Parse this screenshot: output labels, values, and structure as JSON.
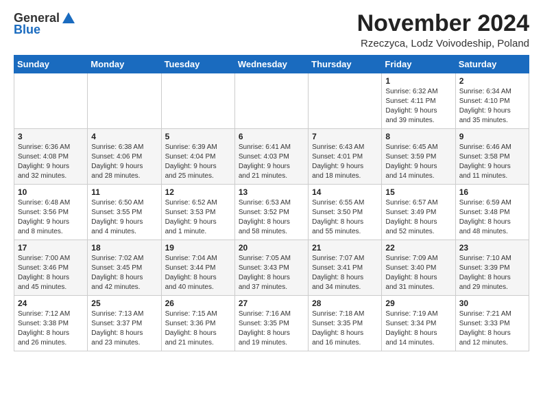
{
  "logo": {
    "general": "General",
    "blue": "Blue"
  },
  "title": "November 2024",
  "subtitle": "Rzeczyca, Lodz Voivodeship, Poland",
  "weekdays": [
    "Sunday",
    "Monday",
    "Tuesday",
    "Wednesday",
    "Thursday",
    "Friday",
    "Saturday"
  ],
  "weeks": [
    [
      {
        "day": "",
        "info": ""
      },
      {
        "day": "",
        "info": ""
      },
      {
        "day": "",
        "info": ""
      },
      {
        "day": "",
        "info": ""
      },
      {
        "day": "",
        "info": ""
      },
      {
        "day": "1",
        "info": "Sunrise: 6:32 AM\nSunset: 4:11 PM\nDaylight: 9 hours\nand 39 minutes."
      },
      {
        "day": "2",
        "info": "Sunrise: 6:34 AM\nSunset: 4:10 PM\nDaylight: 9 hours\nand 35 minutes."
      }
    ],
    [
      {
        "day": "3",
        "info": "Sunrise: 6:36 AM\nSunset: 4:08 PM\nDaylight: 9 hours\nand 32 minutes."
      },
      {
        "day": "4",
        "info": "Sunrise: 6:38 AM\nSunset: 4:06 PM\nDaylight: 9 hours\nand 28 minutes."
      },
      {
        "day": "5",
        "info": "Sunrise: 6:39 AM\nSunset: 4:04 PM\nDaylight: 9 hours\nand 25 minutes."
      },
      {
        "day": "6",
        "info": "Sunrise: 6:41 AM\nSunset: 4:03 PM\nDaylight: 9 hours\nand 21 minutes."
      },
      {
        "day": "7",
        "info": "Sunrise: 6:43 AM\nSunset: 4:01 PM\nDaylight: 9 hours\nand 18 minutes."
      },
      {
        "day": "8",
        "info": "Sunrise: 6:45 AM\nSunset: 3:59 PM\nDaylight: 9 hours\nand 14 minutes."
      },
      {
        "day": "9",
        "info": "Sunrise: 6:46 AM\nSunset: 3:58 PM\nDaylight: 9 hours\nand 11 minutes."
      }
    ],
    [
      {
        "day": "10",
        "info": "Sunrise: 6:48 AM\nSunset: 3:56 PM\nDaylight: 9 hours\nand 8 minutes."
      },
      {
        "day": "11",
        "info": "Sunrise: 6:50 AM\nSunset: 3:55 PM\nDaylight: 9 hours\nand 4 minutes."
      },
      {
        "day": "12",
        "info": "Sunrise: 6:52 AM\nSunset: 3:53 PM\nDaylight: 9 hours\nand 1 minute."
      },
      {
        "day": "13",
        "info": "Sunrise: 6:53 AM\nSunset: 3:52 PM\nDaylight: 8 hours\nand 58 minutes."
      },
      {
        "day": "14",
        "info": "Sunrise: 6:55 AM\nSunset: 3:50 PM\nDaylight: 8 hours\nand 55 minutes."
      },
      {
        "day": "15",
        "info": "Sunrise: 6:57 AM\nSunset: 3:49 PM\nDaylight: 8 hours\nand 52 minutes."
      },
      {
        "day": "16",
        "info": "Sunrise: 6:59 AM\nSunset: 3:48 PM\nDaylight: 8 hours\nand 48 minutes."
      }
    ],
    [
      {
        "day": "17",
        "info": "Sunrise: 7:00 AM\nSunset: 3:46 PM\nDaylight: 8 hours\nand 45 minutes."
      },
      {
        "day": "18",
        "info": "Sunrise: 7:02 AM\nSunset: 3:45 PM\nDaylight: 8 hours\nand 42 minutes."
      },
      {
        "day": "19",
        "info": "Sunrise: 7:04 AM\nSunset: 3:44 PM\nDaylight: 8 hours\nand 40 minutes."
      },
      {
        "day": "20",
        "info": "Sunrise: 7:05 AM\nSunset: 3:43 PM\nDaylight: 8 hours\nand 37 minutes."
      },
      {
        "day": "21",
        "info": "Sunrise: 7:07 AM\nSunset: 3:41 PM\nDaylight: 8 hours\nand 34 minutes."
      },
      {
        "day": "22",
        "info": "Sunrise: 7:09 AM\nSunset: 3:40 PM\nDaylight: 8 hours\nand 31 minutes."
      },
      {
        "day": "23",
        "info": "Sunrise: 7:10 AM\nSunset: 3:39 PM\nDaylight: 8 hours\nand 29 minutes."
      }
    ],
    [
      {
        "day": "24",
        "info": "Sunrise: 7:12 AM\nSunset: 3:38 PM\nDaylight: 8 hours\nand 26 minutes."
      },
      {
        "day": "25",
        "info": "Sunrise: 7:13 AM\nSunset: 3:37 PM\nDaylight: 8 hours\nand 23 minutes."
      },
      {
        "day": "26",
        "info": "Sunrise: 7:15 AM\nSunset: 3:36 PM\nDaylight: 8 hours\nand 21 minutes."
      },
      {
        "day": "27",
        "info": "Sunrise: 7:16 AM\nSunset: 3:35 PM\nDaylight: 8 hours\nand 19 minutes."
      },
      {
        "day": "28",
        "info": "Sunrise: 7:18 AM\nSunset: 3:35 PM\nDaylight: 8 hours\nand 16 minutes."
      },
      {
        "day": "29",
        "info": "Sunrise: 7:19 AM\nSunset: 3:34 PM\nDaylight: 8 hours\nand 14 minutes."
      },
      {
        "day": "30",
        "info": "Sunrise: 7:21 AM\nSunset: 3:33 PM\nDaylight: 8 hours\nand 12 minutes."
      }
    ]
  ]
}
